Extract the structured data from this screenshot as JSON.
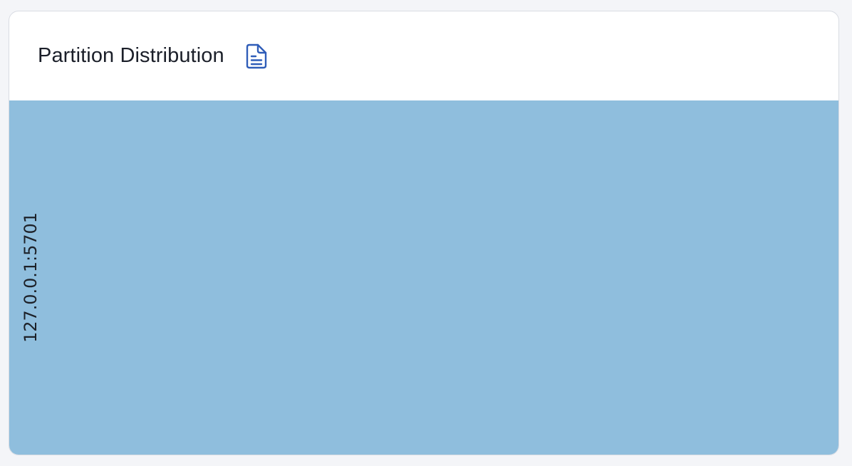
{
  "panel": {
    "title": "Partition Distribution",
    "doc_icon": "document-icon"
  },
  "colors": {
    "background": "#f4f5f8",
    "card": "#ffffff",
    "bar_fill": "#8fbedd",
    "title_text": "#1b1f29",
    "icon": "#2f5db8"
  },
  "chart_data": {
    "type": "bar",
    "orientation": "horizontal",
    "categories": [
      "127.0.0.1:5701"
    ],
    "values": [
      1
    ],
    "xlim": [
      0,
      1
    ],
    "grid": false,
    "legend": "none"
  }
}
